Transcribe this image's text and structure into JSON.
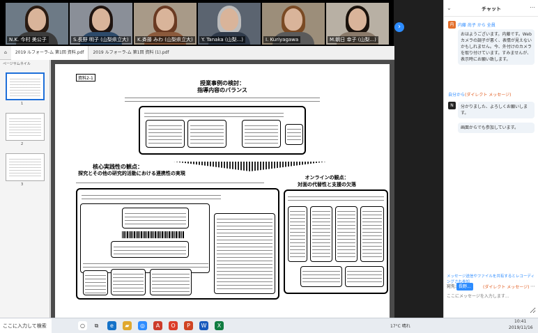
{
  "video_tiles": [
    {
      "name": "N.K. 今村 美公子",
      "bg": "#6d7a86",
      "hair": "#2a1b12",
      "shirt": "#3c3c3c"
    },
    {
      "name": "S.長野 明子 (山梨県立大)",
      "bg": "#8a8f98",
      "hair": "#1f1410",
      "shirt": "#2d4a6a"
    },
    {
      "name": "K.斉藤 みわ (山梨県立大)",
      "bg": "#a89a88",
      "hair": "#6a3a22",
      "shirt": "#8b5a3c"
    },
    {
      "name": "Y. Tanaka (山梨...)",
      "bg": "#5b6470",
      "hair": "#bcbcbc",
      "shirt": "#2f3a4a"
    },
    {
      "name": "I. Kuriyagawa",
      "bg": "#9c8e7a",
      "hair": "#7a4a24",
      "shirt": "#5a5a5a"
    },
    {
      "name": "M.朝日 幸子 (山梨...)",
      "bg": "#b8b0a4",
      "hair": "#1a120c",
      "shirt": "#8a7a6a"
    }
  ],
  "pdf": {
    "tabs": [
      "2019 ルフォーラ-ム 第1回 資料.pdf",
      "2019 ルフォーラ-ム 第1回 資料 (1).pdf"
    ],
    "thumb_title": "ページサムネイル",
    "thumbs": [
      "1",
      "2",
      "3"
    ],
    "page_label": "資料2-1",
    "title_1": "授業事例の検討：",
    "title_2": "指導内容のバランス",
    "title_3": "核心実践性の観点：",
    "title_4": "探究とその他の研究的活動における連携性の実現",
    "title_5": "オンラインの観点：",
    "title_6": "対面の代替性と支援の欠落"
  },
  "chat": {
    "title": "チャット",
    "messages": [
      {
        "sender": "内藤 尚子 から 全員",
        "avatar": "内",
        "avatar_color": "#e36f2c",
        "text": "おはようございます。内藤です。Webカメラの調子が悪く、表情が見えないかもしれません。今、外付けのカメラを取り付けています。すみませんが、表示時にお願い致します。",
        "dm": ""
      },
      {
        "sender": "自分から",
        "avatar": "",
        "avatar_color": "#ffffff",
        "text": "",
        "dm": "(ダイレクト メッセージ)"
      },
      {
        "sender": "",
        "avatar": "N",
        "avatar_color": "#222222",
        "text": "分かりました、よろしくお願いします。",
        "dm": ""
      },
      {
        "sender": "",
        "avatar": "",
        "avatar_color": "#ffffff",
        "text": "画面からでも参加しています。",
        "dm": ""
      }
    ],
    "notice": "メッセージ送信やファイルを共有するとレコーディングされ参加",
    "to_label": "宛先:",
    "to_value": "長野...",
    "to_dm": "(ダイレクト メッセージ)",
    "input_placeholder": "ここにメッセージを入力します..."
  },
  "taskbar": {
    "search_text": "ここに入力して検索",
    "weather": "17°C 晴れ",
    "time": "10:41",
    "date": "2019/11/16"
  }
}
